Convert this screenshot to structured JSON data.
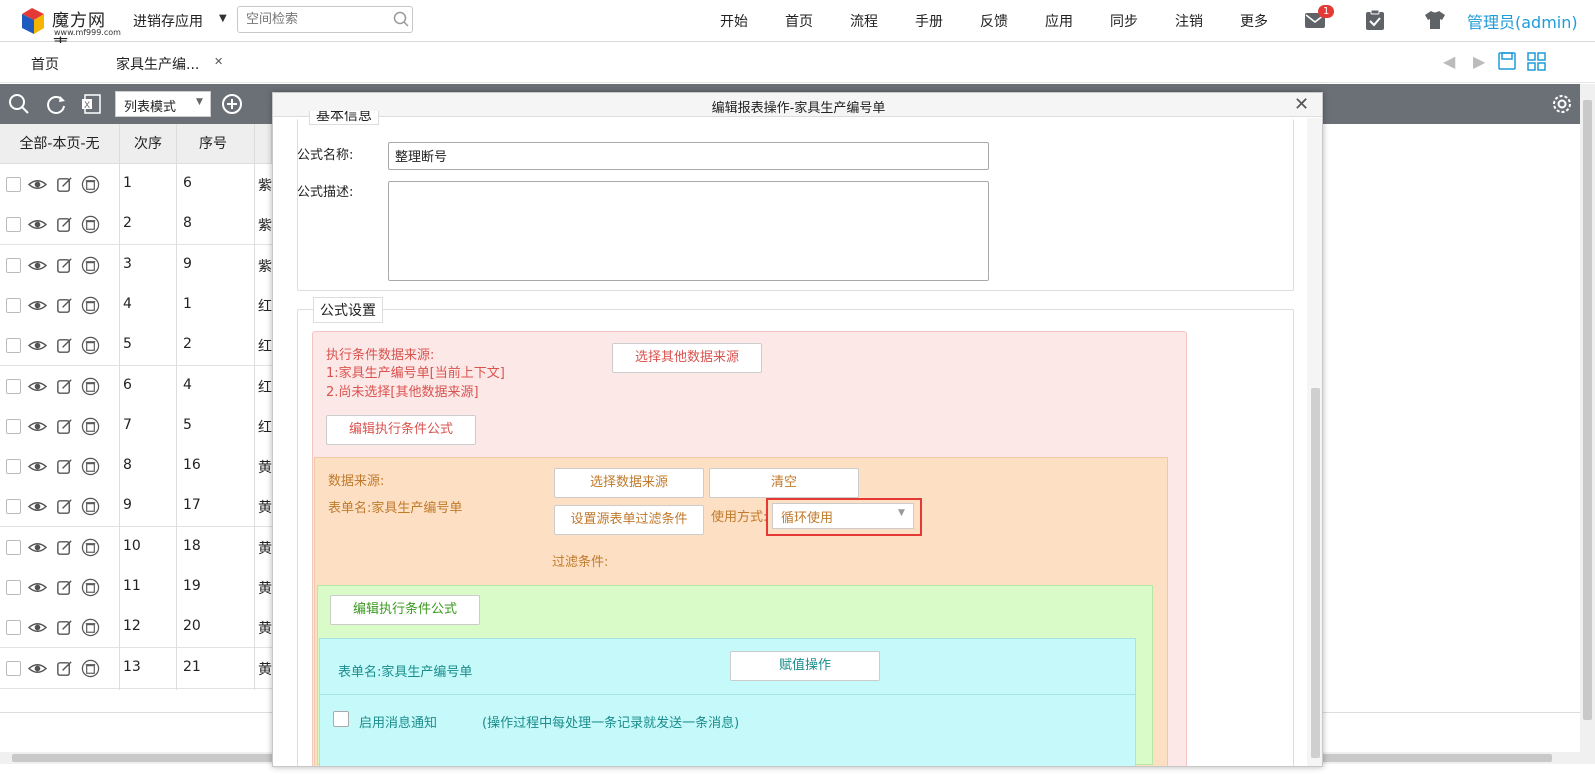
{
  "app": {
    "logo_title": "魔方网表",
    "logo_sub": "www.mf999.com",
    "app_name": "进销存应用",
    "search_placeholder": "空间检索",
    "nav": [
      "开始",
      "首页",
      "流程",
      "手册",
      "反馈",
      "应用",
      "同步",
      "注销",
      "更多"
    ],
    "mail_badge": "1",
    "user": "管理员(admin)"
  },
  "tabs": [
    {
      "label": "首页"
    },
    {
      "label": "家具生产编..."
    }
  ],
  "toolbar": {
    "mode": "列表模式"
  },
  "table": {
    "headers": [
      "全部-本页-无",
      "次序",
      "序号"
    ],
    "rows": [
      {
        "seq": "1",
        "no": "6",
        "c": "紫"
      },
      {
        "seq": "2",
        "no": "8",
        "c": "紫"
      },
      {
        "seq": "3",
        "no": "9",
        "c": "紫"
      },
      {
        "seq": "4",
        "no": "1",
        "c": "红"
      },
      {
        "seq": "5",
        "no": "2",
        "c": "红"
      },
      {
        "seq": "6",
        "no": "4",
        "c": "红"
      },
      {
        "seq": "7",
        "no": "5",
        "c": "红"
      },
      {
        "seq": "8",
        "no": "16",
        "c": "黄"
      },
      {
        "seq": "9",
        "no": "17",
        "c": "黄"
      },
      {
        "seq": "10",
        "no": "18",
        "c": "黄"
      },
      {
        "seq": "11",
        "no": "19",
        "c": "黄"
      },
      {
        "seq": "12",
        "no": "20",
        "c": "黄"
      },
      {
        "seq": "13",
        "no": "21",
        "c": "黄"
      }
    ]
  },
  "dialog": {
    "title": "编辑报表操作-家具生产编号单",
    "basic_legend": "基本信息",
    "formula_name_label": "公式名称:",
    "formula_name_value": "整理断号",
    "formula_desc_label": "公式描述:",
    "settings_legend": "公式设置",
    "red": {
      "source_title": "执行条件数据来源:",
      "source_line1": "1:家具生产编号单[当前上下文]",
      "source_line2": "2.尚未选择[其他数据来源]",
      "choose_other_btn": "选择其他数据来源",
      "edit_cond_btn": "编辑执行条件公式"
    },
    "orange": {
      "source_label": "数据来源:",
      "form_name": "表单名:家具生产编号单",
      "choose_source_btn": "选择数据来源",
      "clear_btn": "清空",
      "filter_btn": "设置源表单过滤条件",
      "usage_label": "使用方式:",
      "usage_value": "循环使用",
      "filter_cond": "过滤条件:"
    },
    "green": {
      "edit_cond_btn": "编辑执行条件公式"
    },
    "cyan": {
      "form_name": "表单名:家具生产编号单",
      "assign_btn": "赋值操作",
      "notify_label": "启用消息通知",
      "notify_note": "(操作过程中每处理一条记录就发送一条消息)"
    }
  },
  "colors": {
    "toolbar": "#6b7077",
    "admin": "#1f9bd9",
    "red_panel": "#fde8e8",
    "orange_panel": "#fde0c4",
    "green_panel": "#d8fbc8",
    "cyan_panel": "#c6fafa",
    "highlight": "#e53935"
  }
}
